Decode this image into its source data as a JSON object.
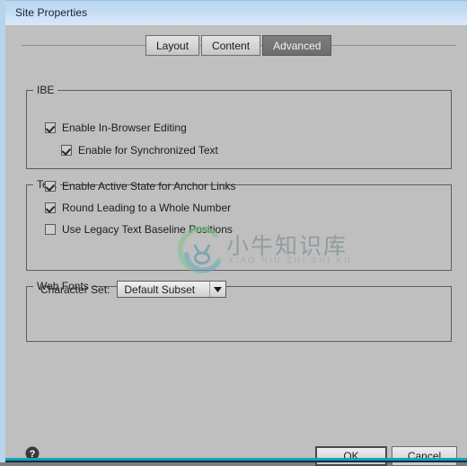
{
  "window": {
    "title": "Site Properties"
  },
  "tabs": [
    {
      "label": "Layout",
      "selected": false
    },
    {
      "label": "Content",
      "selected": false
    },
    {
      "label": "Advanced",
      "selected": true
    }
  ],
  "groups": {
    "ibe": {
      "legend": "IBE",
      "options": [
        {
          "label": "Enable In-Browser Editing",
          "checked": true,
          "indent": 0
        },
        {
          "label": "Enable for Synchronized Text",
          "checked": true,
          "indent": 1
        }
      ]
    },
    "text": {
      "legend": "Text",
      "options": [
        {
          "label": "Enable Active State for Anchor Links",
          "checked": true,
          "indent": 0
        },
        {
          "label": "Round Leading to a Whole Number",
          "checked": true,
          "indent": 0
        },
        {
          "label": "Use Legacy Text Baseline Positions",
          "checked": false,
          "indent": 0
        }
      ]
    },
    "web_fonts": {
      "legend": "Web Fonts",
      "character_set": {
        "label": "Character Set:",
        "value": "Default Subset",
        "arrow_icon": "chevron-down-icon"
      }
    }
  },
  "footer": {
    "help_icon": "help-circle-icon",
    "ok_label": "OK",
    "cancel_label": "Cancel"
  },
  "watermark": {
    "chinese": "小牛知识库",
    "pinyin": "XIAO NIU ZHI SHI KU"
  },
  "colors": {
    "dialog_background": "#bfbfbf",
    "titlebar_top": "#b9d6ef",
    "titlebar_bottom": "#d6e8f8",
    "window_border": "#b6d4ec",
    "selected_tab": "#757575",
    "group_border": "#5e5e5e",
    "accent_bottom": "#12a3b8"
  }
}
